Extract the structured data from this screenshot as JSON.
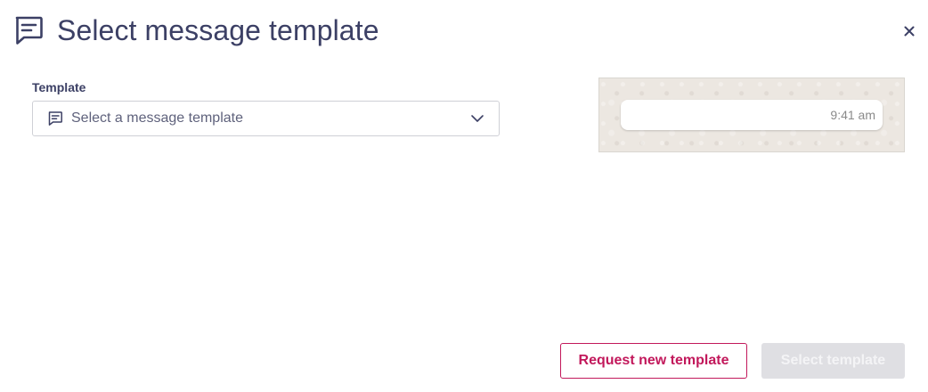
{
  "dialog": {
    "title": "Select message template",
    "title_icon": "chat-message-icon",
    "close_icon": "close-icon"
  },
  "form": {
    "template_label": "Template",
    "template_select": {
      "placeholder": "Select a message template",
      "icon": "chat-message-icon",
      "dropdown_icon": "chevron-down-icon"
    }
  },
  "preview": {
    "timestamp": "9:41 am"
  },
  "footer": {
    "request_button_label": "Request new template",
    "select_button_label": "Select template",
    "select_button_disabled": true
  },
  "colors": {
    "title_text": "#3c4065",
    "accent": "#c2185b",
    "disabled_button_bg": "#dfdfe3",
    "preview_bg": "#ece7e1"
  }
}
